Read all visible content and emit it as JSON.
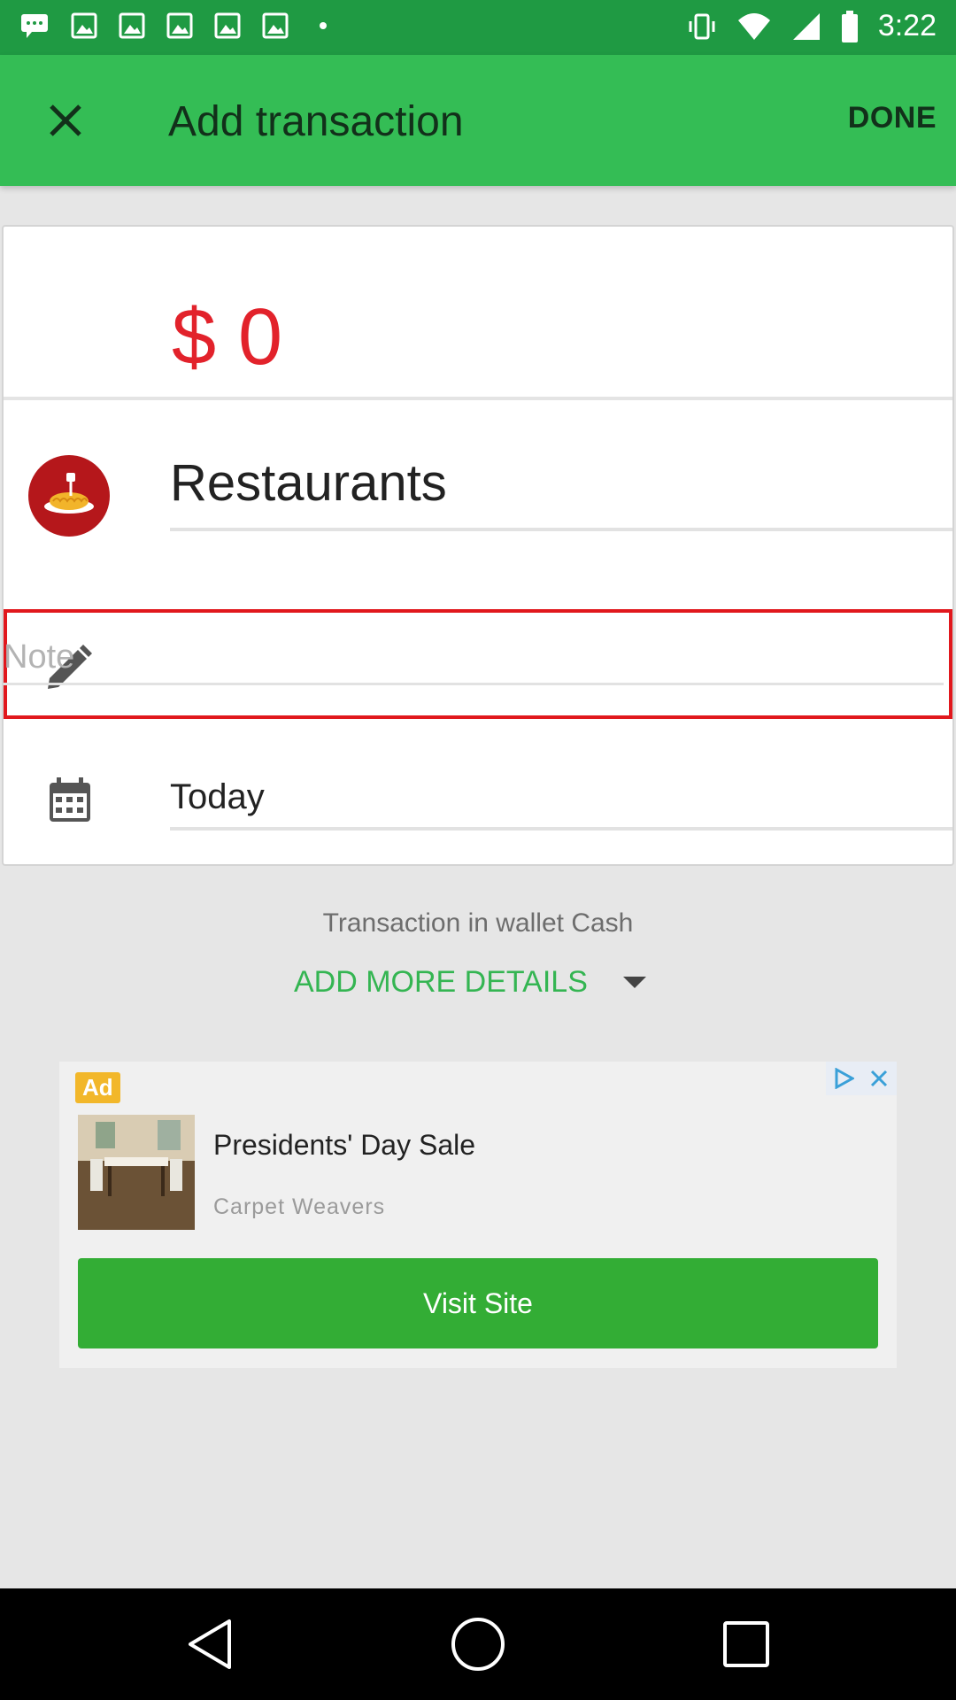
{
  "status_bar": {
    "time": "3:22",
    "left_icons": [
      "chat-icon",
      "image-icon",
      "image-icon",
      "image-icon",
      "image-icon",
      "image-icon",
      "more-dots-icon"
    ],
    "right_icons": [
      "vibrate-icon",
      "wifi-icon",
      "signal-icon",
      "battery-icon"
    ]
  },
  "app_bar": {
    "title": "Add transaction",
    "done_label": "DONE",
    "close_icon": "close-icon"
  },
  "amount": {
    "currency": "$",
    "value": "0",
    "display": "$ 0",
    "color": "#e2222b"
  },
  "category": {
    "label": "Restaurants",
    "icon": "restaurant-icon",
    "icon_color": "#b5171b"
  },
  "note": {
    "placeholder": "Note",
    "value": "",
    "icon": "pencil-icon"
  },
  "date": {
    "label": "Today",
    "icon": "calendar-icon"
  },
  "wallet_text": "Transaction in wallet Cash",
  "more_details_label": "ADD MORE DETAILS",
  "ad": {
    "badge": "Ad",
    "title": "Presidents' Day Sale",
    "advertiser": "Carpet Weavers",
    "cta": "Visit Site"
  },
  "colors": {
    "app_bar": "#34bd55",
    "status_bar": "#1f9a43",
    "accent": "#34b552",
    "highlight_border": "#e1181d"
  }
}
